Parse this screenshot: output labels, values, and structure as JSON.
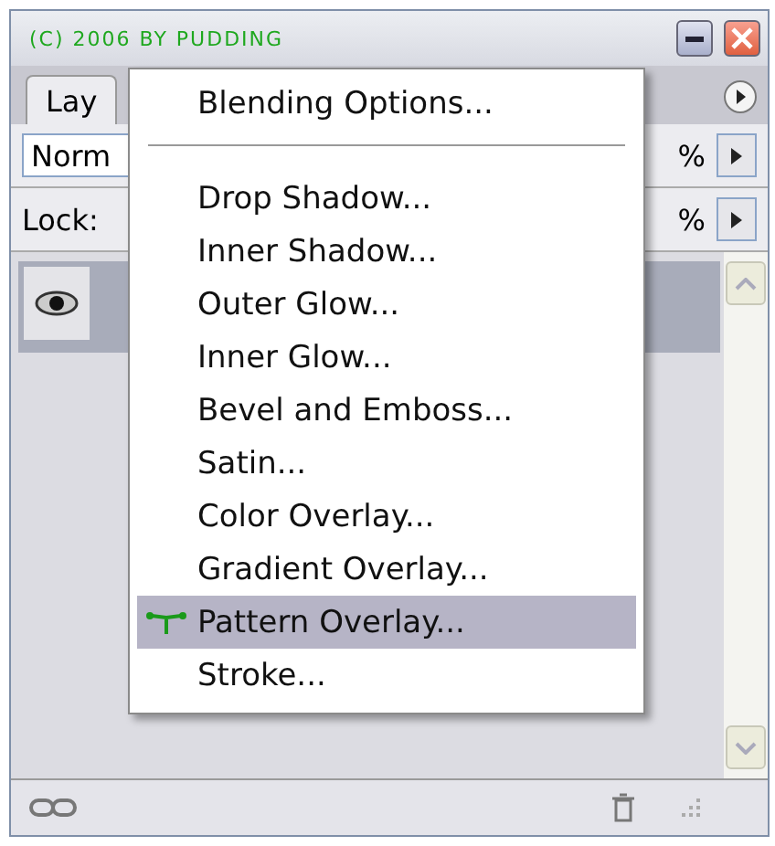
{
  "window": {
    "title": "(C) 2006 BY PUDDING"
  },
  "tabs": [
    {
      "label": "Lay",
      "selected": true
    }
  ],
  "blend_mode": {
    "value": "Norm"
  },
  "opacity": {
    "value": "%"
  },
  "lock": {
    "label": "Lock:"
  },
  "fill": {
    "value": "%"
  },
  "layers": [
    {
      "visible": true,
      "selected": true
    }
  ],
  "menu": {
    "items": [
      {
        "kind": "item",
        "label": "Blending Options...",
        "selected": false
      },
      {
        "kind": "separator"
      },
      {
        "kind": "item",
        "label": "Drop Shadow...",
        "selected": false
      },
      {
        "kind": "item",
        "label": "Inner Shadow...",
        "selected": false
      },
      {
        "kind": "item",
        "label": "Outer Glow...",
        "selected": false
      },
      {
        "kind": "item",
        "label": "Inner Glow...",
        "selected": false
      },
      {
        "kind": "item",
        "label": "Bevel and Emboss...",
        "selected": false
      },
      {
        "kind": "item",
        "label": "Satin...",
        "selected": false
      },
      {
        "kind": "item",
        "label": "Color Overlay...",
        "selected": false
      },
      {
        "kind": "item",
        "label": "Gradient Overlay...",
        "selected": false
      },
      {
        "kind": "item",
        "label": "Pattern Overlay...",
        "selected": true
      },
      {
        "kind": "item",
        "label": "Stroke...",
        "selected": false
      }
    ]
  }
}
